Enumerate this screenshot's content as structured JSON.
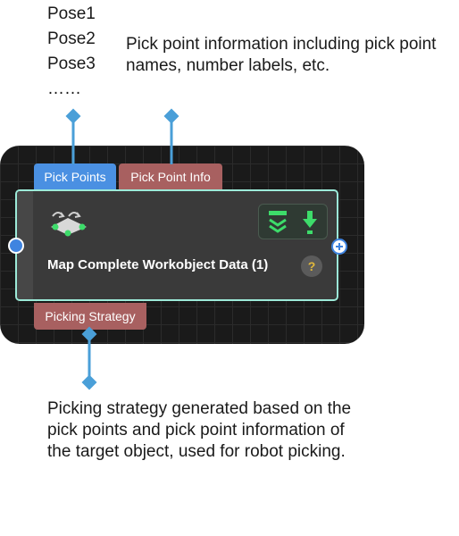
{
  "poses": [
    "Pose1",
    "Pose2",
    "Pose3",
    "……"
  ],
  "annotations": {
    "top": "Pick point information including pick point names, number labels, etc.",
    "bottom": "Picking strategy generated based on the pick points and pick point information of the target object, used for robot picking."
  },
  "node": {
    "title": "Map Complete Workobject Data (1)",
    "help": "?",
    "inputs": [
      {
        "label": "Pick Points",
        "color": "#4a90e2"
      },
      {
        "label": "Pick Point Info",
        "color": "#a86060"
      }
    ],
    "outputs": [
      {
        "label": "Picking Strategy",
        "color": "#a86060"
      }
    ],
    "border_color": "#9cead8",
    "status_icons": [
      "collapse-chevron-icon",
      "download-arrow-icon"
    ]
  },
  "colors": {
    "connector": "#4a9fd8",
    "canvas": "#1a1a1a",
    "accent_green": "#3ddc6a"
  }
}
